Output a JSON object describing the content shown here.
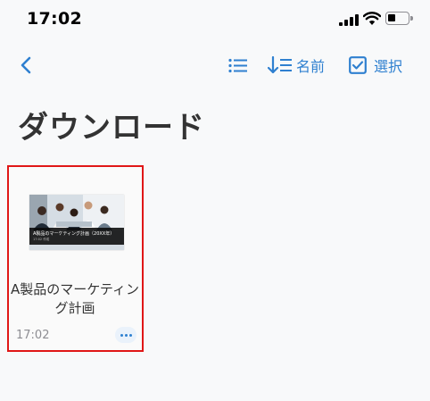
{
  "status_bar": {
    "time": "17:02"
  },
  "nav": {
    "sort_label": "名前",
    "select_label": "選択"
  },
  "page": {
    "title": "ダウンロード"
  },
  "files": [
    {
      "name": "A製品のマーケティング計画",
      "time": "17:02",
      "thumbnail_caption": "A製品のマーケティング計画（20XX年）",
      "thumbnail_subcaption": "17:02 作成"
    }
  ],
  "colors": {
    "accent": "#2f80d0",
    "highlight_border": "#e01717",
    "title": "#333333",
    "muted": "#8e8e93"
  },
  "icons": {
    "back": "chevron-left-icon",
    "list_view": "list-icon",
    "sort": "sort-arrow-icon",
    "select": "checkbox-icon",
    "more": "ellipsis-icon"
  }
}
